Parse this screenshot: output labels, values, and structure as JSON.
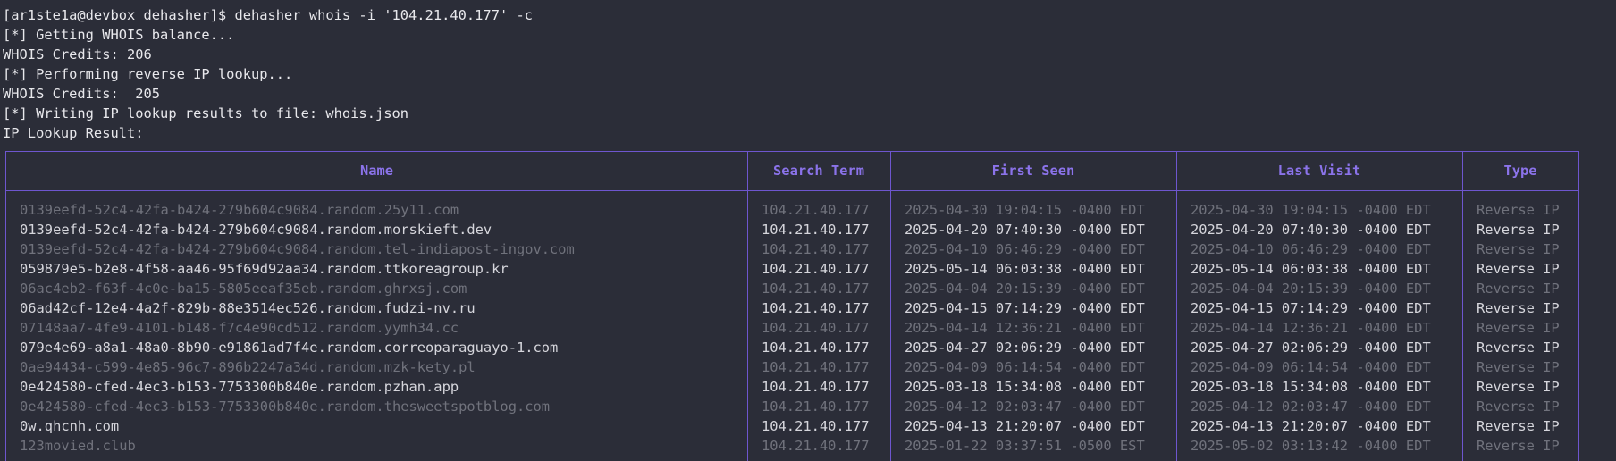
{
  "terminal": {
    "lines": [
      "[ar1ste1a@devbox dehasher]$ dehasher whois -i '104.21.40.177' -c",
      "[*] Getting WHOIS balance...",
      "WHOIS Credits: 206",
      "[*] Performing reverse IP lookup...",
      "WHOIS Credits:  205",
      "[*] Writing IP lookup results to file: whois.json",
      "IP Lookup Result:"
    ]
  },
  "table": {
    "headers": [
      "Name",
      "Search Term",
      "First Seen",
      "Last Visit",
      "Type"
    ],
    "rows": [
      {
        "style": "dim",
        "cells": [
          "0139eefd-52c4-42fa-b424-279b604c9084.random.25y11.com",
          "104.21.40.177",
          "2025-04-30 19:04:15 -0400 EDT",
          "2025-04-30 19:04:15 -0400 EDT",
          "Reverse IP"
        ]
      },
      {
        "style": "bright",
        "cells": [
          "0139eefd-52c4-42fa-b424-279b604c9084.random.morskieft.dev",
          "104.21.40.177",
          "2025-04-20 07:40:30 -0400 EDT",
          "2025-04-20 07:40:30 -0400 EDT",
          "Reverse IP"
        ]
      },
      {
        "style": "dim",
        "cells": [
          "0139eefd-52c4-42fa-b424-279b604c9084.random.tel-indiapost-ingov.com",
          "104.21.40.177",
          "2025-04-10 06:46:29 -0400 EDT",
          "2025-04-10 06:46:29 -0400 EDT",
          "Reverse IP"
        ]
      },
      {
        "style": "bright",
        "cells": [
          "059879e5-b2e8-4f58-aa46-95f69d92aa34.random.ttkoreagroup.kr",
          "104.21.40.177",
          "2025-05-14 06:03:38 -0400 EDT",
          "2025-05-14 06:03:38 -0400 EDT",
          "Reverse IP"
        ]
      },
      {
        "style": "dim",
        "cells": [
          "06ac4eb2-f63f-4c0e-ba15-5805eeaf35eb.random.ghrxsj.com",
          "104.21.40.177",
          "2025-04-04 20:15:39 -0400 EDT",
          "2025-04-04 20:15:39 -0400 EDT",
          "Reverse IP"
        ]
      },
      {
        "style": "bright",
        "cells": [
          "06ad42cf-12e4-4a2f-829b-88e3514ec526.random.fudzi-nv.ru",
          "104.21.40.177",
          "2025-04-15 07:14:29 -0400 EDT",
          "2025-04-15 07:14:29 -0400 EDT",
          "Reverse IP"
        ]
      },
      {
        "style": "dim",
        "cells": [
          "07148aa7-4fe9-4101-b148-f7c4e90cd512.random.yymh34.cc",
          "104.21.40.177",
          "2025-04-14 12:36:21 -0400 EDT",
          "2025-04-14 12:36:21 -0400 EDT",
          "Reverse IP"
        ]
      },
      {
        "style": "bright",
        "cells": [
          "079e4e69-a8a1-48a0-8b90-e91861ad7f4e.random.correoparaguayo-1.com",
          "104.21.40.177",
          "2025-04-27 02:06:29 -0400 EDT",
          "2025-04-27 02:06:29 -0400 EDT",
          "Reverse IP"
        ]
      },
      {
        "style": "dim",
        "cells": [
          "0ae94434-c599-4e85-96c7-896b2247a34d.random.mzk-kety.pl",
          "104.21.40.177",
          "2025-04-09 06:14:54 -0400 EDT",
          "2025-04-09 06:14:54 -0400 EDT",
          "Reverse IP"
        ]
      },
      {
        "style": "bright",
        "cells": [
          "0e424580-cfed-4ec3-b153-7753300b840e.random.pzhan.app",
          "104.21.40.177",
          "2025-03-18 15:34:08 -0400 EDT",
          "2025-03-18 15:34:08 -0400 EDT",
          "Reverse IP"
        ]
      },
      {
        "style": "dim",
        "cells": [
          "0e424580-cfed-4ec3-b153-7753300b840e.random.thesweetspotblog.com",
          "104.21.40.177",
          "2025-04-12 02:03:47 -0400 EDT",
          "2025-04-12 02:03:47 -0400 EDT",
          "Reverse IP"
        ]
      },
      {
        "style": "bright",
        "cells": [
          "0w.qhcnh.com",
          "104.21.40.177",
          "2025-04-13 21:20:07 -0400 EDT",
          "2025-04-13 21:20:07 -0400 EDT",
          "Reverse IP"
        ]
      },
      {
        "style": "dim",
        "cells": [
          "123movied.club",
          "104.21.40.177",
          "2025-01-22 03:37:51 -0500 EST",
          "2025-05-02 03:13:42 -0400 EDT",
          "Reverse IP"
        ]
      }
    ]
  }
}
